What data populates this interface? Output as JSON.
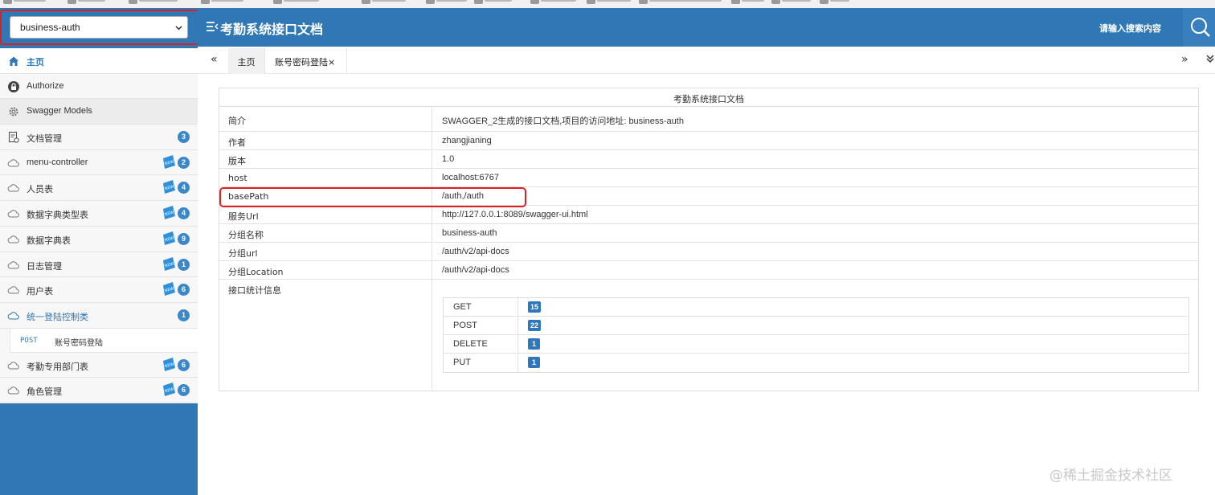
{
  "group_select": {
    "value": "business-auth"
  },
  "header": {
    "title": "考勤系统接口文档",
    "search_placeholder": "请输入搜索内容"
  },
  "sidebar": {
    "items": [
      {
        "label": "主页",
        "icon": "home-icon",
        "active": true
      },
      {
        "label": "Authorize",
        "icon": "lock-icon"
      },
      {
        "label": "Swagger Models",
        "icon": "gear-icon"
      },
      {
        "label": "文档管理",
        "icon": "document-settings-icon",
        "count": "3"
      },
      {
        "label": "menu-controller",
        "icon": "cloud-icon",
        "count": "2",
        "new": true
      },
      {
        "label": "人员表",
        "icon": "cloud-icon",
        "count": "4",
        "new": true
      },
      {
        "label": "数据字典类型表",
        "icon": "cloud-icon",
        "count": "4",
        "new": true
      },
      {
        "label": "数据字典表",
        "icon": "cloud-icon",
        "count": "9",
        "new": true
      },
      {
        "label": "日志管理",
        "icon": "cloud-icon",
        "count": "1",
        "new": true
      },
      {
        "label": "用户表",
        "icon": "cloud-icon",
        "count": "6",
        "new": true
      },
      {
        "label": "统一登陆控制类",
        "icon": "cloud-icon",
        "count": "1",
        "expanded": true
      },
      {
        "label": "考勤专用部门表",
        "icon": "cloud-icon",
        "count": "6",
        "new": true
      },
      {
        "label": "角色管理",
        "icon": "cloud-icon",
        "count": "6",
        "new": true
      }
    ],
    "sub_item": {
      "method": "POST",
      "label": "账号密码登陆"
    }
  },
  "tabs": {
    "items": [
      {
        "label": "主页"
      },
      {
        "label": "账号密码登陆"
      }
    ],
    "close_glyph": "×"
  },
  "doc": {
    "caption": "考勤系统接口文档",
    "rows": [
      {
        "key": "简介",
        "value": "SWAGGER_2生成的接口文档,项目的访问地址: business-auth"
      },
      {
        "key": "作者",
        "value": "zhangjianing"
      },
      {
        "key": "版本",
        "value": "1.0"
      },
      {
        "key": "host",
        "value": "localhost:6767"
      },
      {
        "key": "basePath",
        "value": "/auth,/auth"
      },
      {
        "key": "服务Url",
        "value": "http://127.0.0.1:8089/swagger-ui.html"
      },
      {
        "key": "分组名称",
        "value": "business-auth"
      },
      {
        "key": "分组url",
        "value": "/auth/v2/api-docs"
      },
      {
        "key": "分组Location",
        "value": "/auth/v2/api-docs"
      }
    ],
    "stats_label": "接口统计信息",
    "stats": [
      {
        "method": "GET",
        "count": "15"
      },
      {
        "method": "POST",
        "count": "22"
      },
      {
        "method": "DELETE",
        "count": "1"
      },
      {
        "method": "PUT",
        "count": "1"
      }
    ]
  },
  "watermark": "@稀土掘金技术社区",
  "colors": {
    "primary": "#2f78b5",
    "badge": "#3b87c8",
    "highlight": "#e02020"
  }
}
